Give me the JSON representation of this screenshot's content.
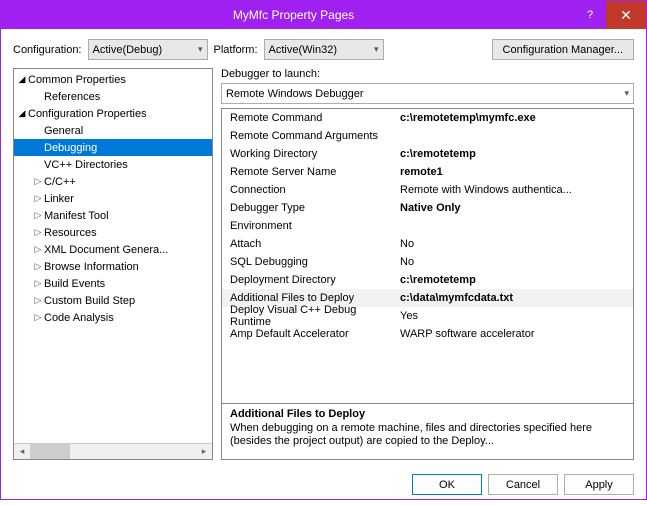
{
  "title": "MyMfc Property Pages",
  "toprow": {
    "config_label": "Configuration:",
    "config_value": "Active(Debug)",
    "platform_label": "Platform:",
    "platform_value": "Active(Win32)",
    "configmgr": "Configuration Manager..."
  },
  "tree": [
    {
      "label": "Common Properties",
      "lvl": 0,
      "arrow": "filled"
    },
    {
      "label": "References",
      "lvl": 1,
      "arrow": ""
    },
    {
      "label": "Configuration Properties",
      "lvl": 0,
      "arrow": "filled"
    },
    {
      "label": "General",
      "lvl": 1,
      "arrow": ""
    },
    {
      "label": "Debugging",
      "lvl": 1,
      "arrow": "",
      "selected": true
    },
    {
      "label": "VC++ Directories",
      "lvl": 1,
      "arrow": ""
    },
    {
      "label": "C/C++",
      "lvl": 1,
      "arrow": "open"
    },
    {
      "label": "Linker",
      "lvl": 1,
      "arrow": "open"
    },
    {
      "label": "Manifest Tool",
      "lvl": 1,
      "arrow": "open"
    },
    {
      "label": "Resources",
      "lvl": 1,
      "arrow": "open"
    },
    {
      "label": "XML Document Genera...",
      "lvl": 1,
      "arrow": "open"
    },
    {
      "label": "Browse Information",
      "lvl": 1,
      "arrow": "open"
    },
    {
      "label": "Build Events",
      "lvl": 1,
      "arrow": "open"
    },
    {
      "label": "Custom Build Step",
      "lvl": 1,
      "arrow": "open"
    },
    {
      "label": "Code Analysis",
      "lvl": 1,
      "arrow": "open"
    }
  ],
  "launch": {
    "label": "Debugger to launch:",
    "value": "Remote Windows Debugger"
  },
  "props": [
    {
      "name": "Remote Command",
      "value": "c:\\remotetemp\\mymfc.exe",
      "bold": true
    },
    {
      "name": "Remote Command Arguments",
      "value": ""
    },
    {
      "name": "Working Directory",
      "value": "c:\\remotetemp",
      "bold": true
    },
    {
      "name": "Remote Server Name",
      "value": "remote1",
      "bold": true
    },
    {
      "name": "Connection",
      "value": "Remote with Windows authentica..."
    },
    {
      "name": "Debugger Type",
      "value": "Native Only",
      "bold": true
    },
    {
      "name": "Environment",
      "value": ""
    },
    {
      "name": "Attach",
      "value": "No"
    },
    {
      "name": "SQL Debugging",
      "value": "No"
    },
    {
      "name": "Deployment Directory",
      "value": "c:\\remotetemp",
      "bold": true
    },
    {
      "name": "Additional Files to Deploy",
      "value": "c:\\data\\mymfcdata.txt",
      "bold": true,
      "hl": true
    },
    {
      "name": "Deploy Visual C++ Debug Runtime",
      "value": "Yes"
    },
    {
      "name": "Amp Default Accelerator",
      "value": "WARP software accelerator"
    }
  ],
  "desc": {
    "title": "Additional Files to Deploy",
    "body": "When debugging on a remote machine, files and directories specified here (besides the project output) are copied to the Deploy..."
  },
  "buttons": {
    "ok": "OK",
    "cancel": "Cancel",
    "apply": "Apply"
  }
}
